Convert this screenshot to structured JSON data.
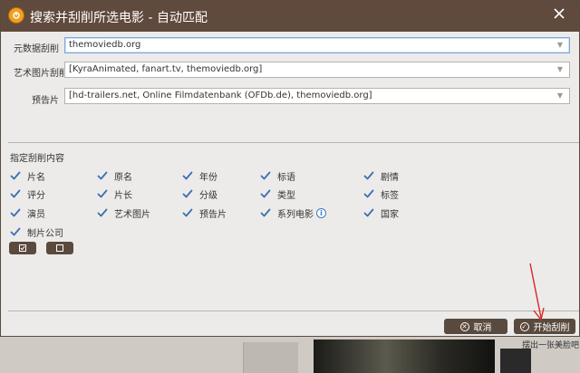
{
  "dialog": {
    "title": "搜索并刮削所选电影 - 自动匹配",
    "fields": [
      {
        "label": "元数据刮削",
        "value": "themoviedb.org"
      },
      {
        "label": "艺术图片刮削",
        "value": "[KyraAnimated, fanart.tv, themoviedb.org]"
      },
      {
        "label": "预告片",
        "value": "[hd-trailers.net, Online Filmdatenbank (OFDb.de), themoviedb.org]"
      }
    ],
    "section_title": "指定刮削内容",
    "checkboxes": [
      {
        "label": "片名",
        "checked": true
      },
      {
        "label": "原名",
        "checked": true
      },
      {
        "label": "年份",
        "checked": true
      },
      {
        "label": "标语",
        "checked": true
      },
      {
        "label": "剧情",
        "checked": true
      },
      {
        "label": "评分",
        "checked": true
      },
      {
        "label": "片长",
        "checked": true
      },
      {
        "label": "分级",
        "checked": true
      },
      {
        "label": "类型",
        "checked": true
      },
      {
        "label": "标签",
        "checked": true
      },
      {
        "label": "演员",
        "checked": true
      },
      {
        "label": "艺术图片",
        "checked": true
      },
      {
        "label": "预告片",
        "checked": true
      },
      {
        "label": "系列电影",
        "checked": true
      },
      {
        "label": "国家",
        "checked": true
      },
      {
        "label": "制片公司",
        "checked": true
      }
    ],
    "cancel_label": "取消",
    "start_label": "开始刮削"
  },
  "background": {
    "status_text": "摆出一张美脸吧"
  },
  "colors": {
    "titlebar": "#5f4a3d",
    "button": "#5a4a3e",
    "check": "#3a6fb0",
    "annotation": "#d8262a"
  }
}
